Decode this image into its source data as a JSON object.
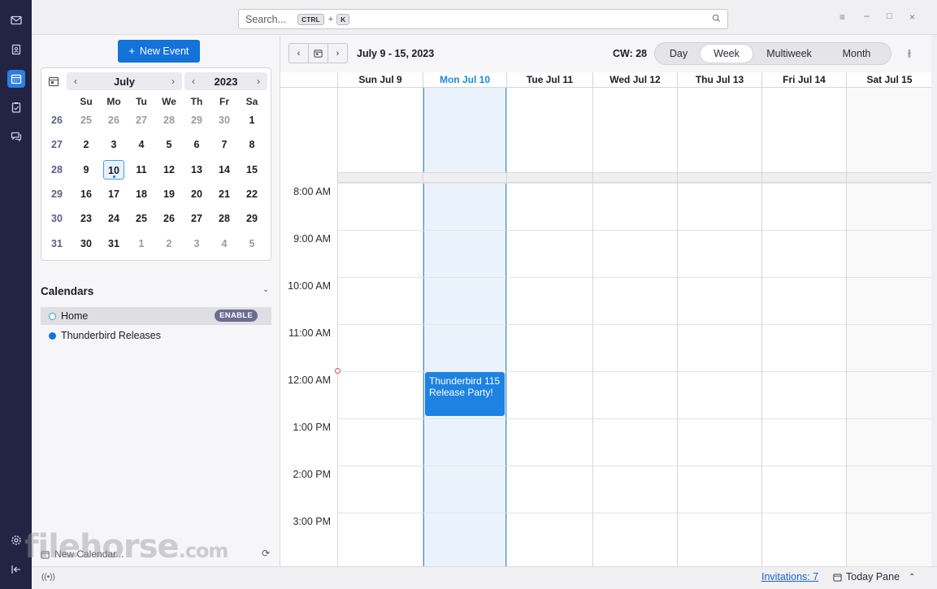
{
  "spaces": [
    "mail-icon",
    "address-book-icon",
    "calendar-icon",
    "tasks-icon",
    "chat-icon",
    "settings-icon",
    "collapse-icon"
  ],
  "search": {
    "placeholder": "Search...",
    "shortcut_mod": "CTRL",
    "shortcut_plus": "+",
    "shortcut_key": "K"
  },
  "sidebar": {
    "new_event_label": "New Event",
    "minical": {
      "month": "July",
      "year": "2023",
      "dow": [
        "Su",
        "Mo",
        "Tu",
        "We",
        "Th",
        "Fr",
        "Sa"
      ],
      "weeks": [
        {
          "wk": "26",
          "days": [
            "25",
            "26",
            "27",
            "28",
            "29",
            "30",
            "1"
          ]
        },
        {
          "wk": "27",
          "days": [
            "2",
            "3",
            "4",
            "5",
            "6",
            "7",
            "8"
          ]
        },
        {
          "wk": "28",
          "days": [
            "9",
            "10",
            "11",
            "12",
            "13",
            "14",
            "15"
          ]
        },
        {
          "wk": "29",
          "days": [
            "16",
            "17",
            "18",
            "19",
            "20",
            "21",
            "22"
          ]
        },
        {
          "wk": "30",
          "days": [
            "23",
            "24",
            "25",
            "26",
            "27",
            "28",
            "29"
          ]
        },
        {
          "wk": "31",
          "days": [
            "30",
            "31",
            "1",
            "2",
            "3",
            "4",
            "5"
          ]
        }
      ],
      "today": "10"
    },
    "calendars_heading": "Calendars",
    "calendars": [
      {
        "name": "Home",
        "badge": "ENABLE",
        "color": "#2aa7c9"
      },
      {
        "name": "Thunderbird Releases",
        "color": "#1373d9"
      }
    ],
    "new_calendar_label": "New Calendar..."
  },
  "toolbar": {
    "range": "July 9 - 15, 2023",
    "cw": "CW: 28",
    "views": [
      "Day",
      "Week",
      "Multiweek",
      "Month"
    ],
    "active_view": "Week"
  },
  "columns": [
    "Sun Jul 9",
    "Mon Jul 10",
    "Tue Jul 11",
    "Wed Jul 12",
    "Thu Jul 13",
    "Fri Jul 14",
    "Sat Jul 15"
  ],
  "today_column": "Mon Jul 10",
  "hours": [
    "8:00 AM",
    "9:00 AM",
    "10:00 AM",
    "11:00 AM",
    "12:00 AM",
    "1:00 PM",
    "2:00 PM",
    "3:00 PM"
  ],
  "event": {
    "title": "Thunderbird 115 Release Party!",
    "day": "Mon Jul 10",
    "time": "12:00 AM"
  },
  "status": {
    "invitations": "Invitations: 7",
    "today_pane": "Today Pane"
  },
  "watermark": {
    "main": "filehorse",
    "suffix": ".com"
  }
}
